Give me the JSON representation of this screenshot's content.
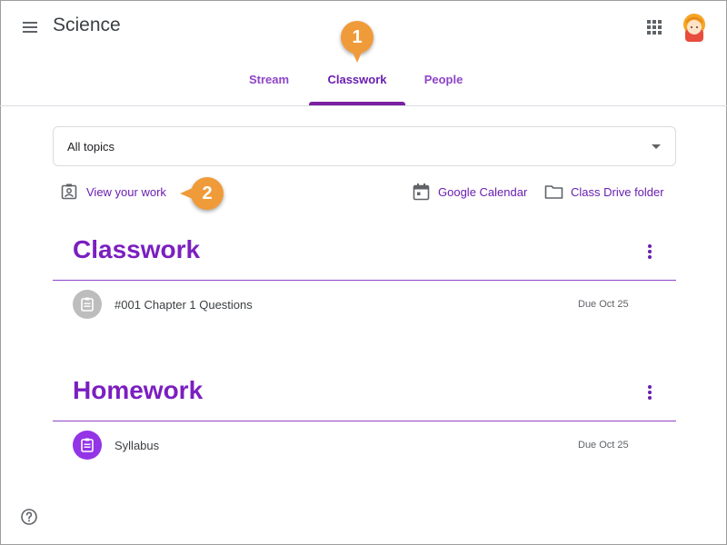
{
  "app": {
    "title": "Science",
    "icons": {
      "menu": "hamburger-menu-icon",
      "apps": "apps-grid-icon",
      "avatar": "user-avatar"
    }
  },
  "tabs": [
    {
      "label": "Stream",
      "selected": false
    },
    {
      "label": "Classwork",
      "selected": true
    },
    {
      "label": "People",
      "selected": false
    }
  ],
  "callouts": {
    "one": "1",
    "two": "2"
  },
  "filter": {
    "value": "All topics"
  },
  "actions": {
    "view_work": "View your work",
    "google_calendar": "Google Calendar",
    "class_drive": "Class Drive folder"
  },
  "sections": [
    {
      "title": "Classwork",
      "items": [
        {
          "title": "#001 Chapter 1 Questions",
          "due": "Due Oct 25",
          "status": "gray"
        }
      ]
    },
    {
      "title": "Homework",
      "items": [
        {
          "title": "Syllabus",
          "due": "Due Oct 25",
          "status": "purple"
        }
      ]
    }
  ],
  "colors": {
    "accent": "#7b1fa2",
    "link": "#6a1fb0",
    "callout": "#f09b39",
    "item_gray": "#bdbdbd",
    "item_purple": "#9334e6"
  }
}
